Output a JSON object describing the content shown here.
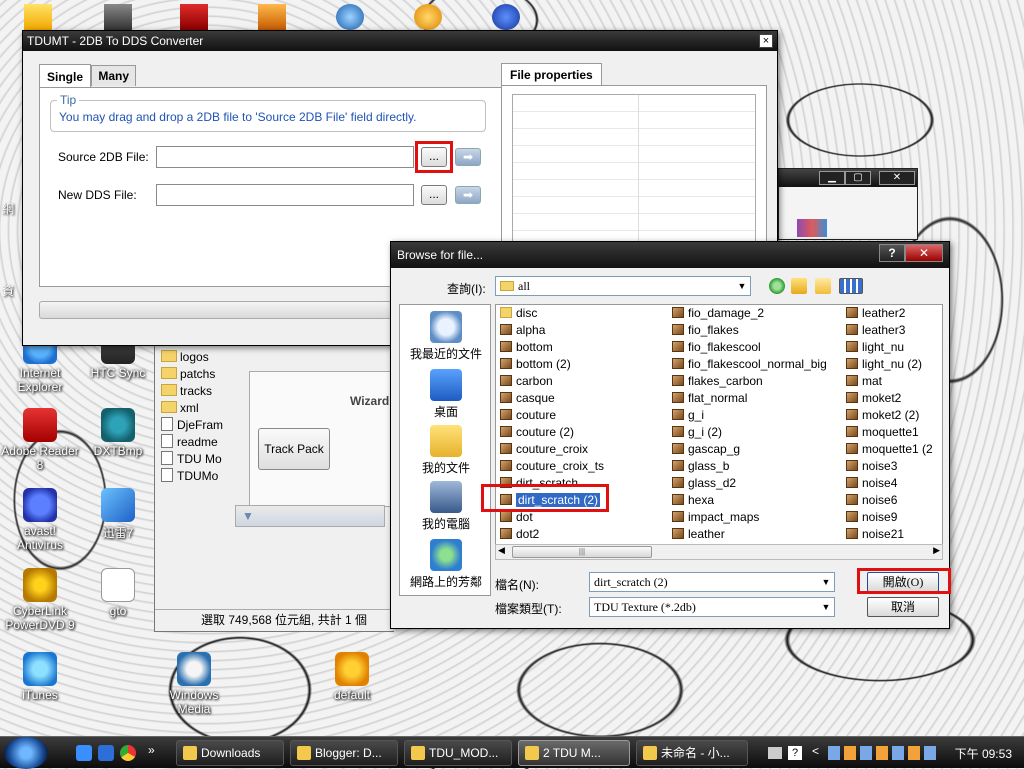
{
  "desktop": {
    "icons_left": [
      {
        "label": "Internet Explorer",
        "icon": "ie-icon"
      },
      {
        "label": "HTC Sync",
        "icon": "htc-sync-icon"
      },
      {
        "label": "Adobe Reader 8",
        "icon": "adobe-reader-icon"
      },
      {
        "label": "DXTBmp",
        "icon": "dxtbmp-icon"
      },
      {
        "label": "avast! Antivirus",
        "icon": "avast-icon"
      },
      {
        "label": "迅雷7",
        "icon": "thunder-icon"
      },
      {
        "label": "CyberLink PowerDVD 9",
        "icon": "powerdvd-icon"
      },
      {
        "label": "gto",
        "icon": "text-file-icon"
      },
      {
        "label": "iTunes",
        "icon": "itunes-icon"
      },
      {
        "label": "Windows Media",
        "icon": "wmp-icon"
      },
      {
        "label": "default",
        "icon": "dat-file-icon"
      }
    ],
    "edge_labels": [
      "網",
      "資"
    ]
  },
  "tdumt": {
    "title": "TDUMT - 2DB To DDS Converter",
    "close": "×",
    "tabs": [
      "Single",
      "Many"
    ],
    "tip_legend": "Tip",
    "tip_text": "You may drag and drop a 2DB file to 'Source 2DB File' field directly.",
    "source_label": "Source 2DB File:",
    "dds_label": "New DDS File:",
    "browse_label": "...",
    "go_label": "➡",
    "file_properties_tab": "File properties"
  },
  "behind": {
    "tree": [
      {
        "type": "folder",
        "label": "logos"
      },
      {
        "type": "folder",
        "label": "patchs"
      },
      {
        "type": "folder",
        "label": "tracks"
      },
      {
        "type": "folder",
        "label": "xml"
      },
      {
        "type": "doc",
        "label": "DjeFram"
      },
      {
        "type": "doc",
        "label": "readme"
      },
      {
        "type": "doc",
        "label": "TDU Mo"
      },
      {
        "type": "doc",
        "label": "TDUMo"
      }
    ],
    "wizard_title": "Wizard",
    "track_pack": "Track Pack",
    "status": "選取 749,568 位元組, 共計 1 個"
  },
  "browse": {
    "title": "Browse for file...",
    "help": "?",
    "close": "✕",
    "lookin_label": "查詢(I):",
    "lookin_value": "all",
    "places": [
      {
        "label": "我最近的文件",
        "icon": "recent-docs-icon"
      },
      {
        "label": "桌面",
        "icon": "desktop-icon"
      },
      {
        "label": "我的文件",
        "icon": "my-documents-icon"
      },
      {
        "label": "我的電腦",
        "icon": "my-computer-icon"
      },
      {
        "label": "網路上的芳鄰",
        "icon": "network-places-icon"
      }
    ],
    "col1": [
      {
        "name": "disc",
        "type": "folder"
      },
      {
        "name": "alpha",
        "type": "tex"
      },
      {
        "name": "bottom",
        "type": "tex"
      },
      {
        "name": "bottom  (2)",
        "type": "tex"
      },
      {
        "name": "carbon",
        "type": "tex"
      },
      {
        "name": "casque",
        "type": "tex"
      },
      {
        "name": "couture",
        "type": "tex"
      },
      {
        "name": "couture  (2)",
        "type": "tex"
      },
      {
        "name": "couture_croix",
        "type": "tex"
      },
      {
        "name": "couture_croix_ts",
        "type": "tex"
      },
      {
        "name": "dirt_scratch",
        "type": "tex"
      },
      {
        "name": "dirt_scratch  (2)",
        "type": "tex",
        "selected": true
      },
      {
        "name": "dot",
        "type": "tex"
      },
      {
        "name": "dot2",
        "type": "tex"
      }
    ],
    "col2": [
      {
        "name": "fio_damage_2",
        "type": "tex"
      },
      {
        "name": "fio_flakes",
        "type": "tex"
      },
      {
        "name": "fio_flakescool",
        "type": "tex"
      },
      {
        "name": "fio_flakescool_normal_big",
        "type": "tex"
      },
      {
        "name": "flakes_carbon",
        "type": "tex"
      },
      {
        "name": "flat_normal",
        "type": "tex"
      },
      {
        "name": "g_i",
        "type": "tex"
      },
      {
        "name": "g_i  (2)",
        "type": "tex"
      },
      {
        "name": "gascap_g",
        "type": "tex"
      },
      {
        "name": "glass_b",
        "type": "tex"
      },
      {
        "name": "glass_d2",
        "type": "tex"
      },
      {
        "name": "hexa",
        "type": "tex"
      },
      {
        "name": "impact_maps",
        "type": "tex"
      },
      {
        "name": "leather",
        "type": "tex"
      }
    ],
    "col3": [
      {
        "name": "leather2",
        "type": "tex"
      },
      {
        "name": "leather3",
        "type": "tex"
      },
      {
        "name": "light_nu",
        "type": "tex"
      },
      {
        "name": "light_nu  (2)",
        "type": "tex"
      },
      {
        "name": "mat",
        "type": "tex"
      },
      {
        "name": "moket2",
        "type": "tex"
      },
      {
        "name": "moket2  (2)",
        "type": "tex"
      },
      {
        "name": "moquette1",
        "type": "tex"
      },
      {
        "name": "moquette1  (2",
        "type": "tex"
      },
      {
        "name": "noise3",
        "type": "tex"
      },
      {
        "name": "noise4",
        "type": "tex"
      },
      {
        "name": "noise6",
        "type": "tex"
      },
      {
        "name": "noise9",
        "type": "tex"
      },
      {
        "name": "noise21",
        "type": "tex"
      }
    ],
    "filename_label": "檔名(N):",
    "filename_value": "dirt_scratch (2)",
    "filetype_label": "檔案類型(T):",
    "filetype_value": "TDU Texture (*.2db)",
    "open_button": "開啟(O)",
    "cancel_button": "取消"
  },
  "taskbar": {
    "buttons": [
      {
        "label": "Downloads",
        "active": false
      },
      {
        "label": "Blogger: D...",
        "active": false
      },
      {
        "label": "TDU_MOD...",
        "active": false
      },
      {
        "label": "2 TDU  M...",
        "active": true
      },
      {
        "label": "未命名 - 小...",
        "active": false
      }
    ],
    "more": "»",
    "clock": "下午 09:53"
  },
  "colors": {
    "highlight": "#e01010",
    "selection": "#316ac5",
    "tip_text": "#1f53b5"
  }
}
